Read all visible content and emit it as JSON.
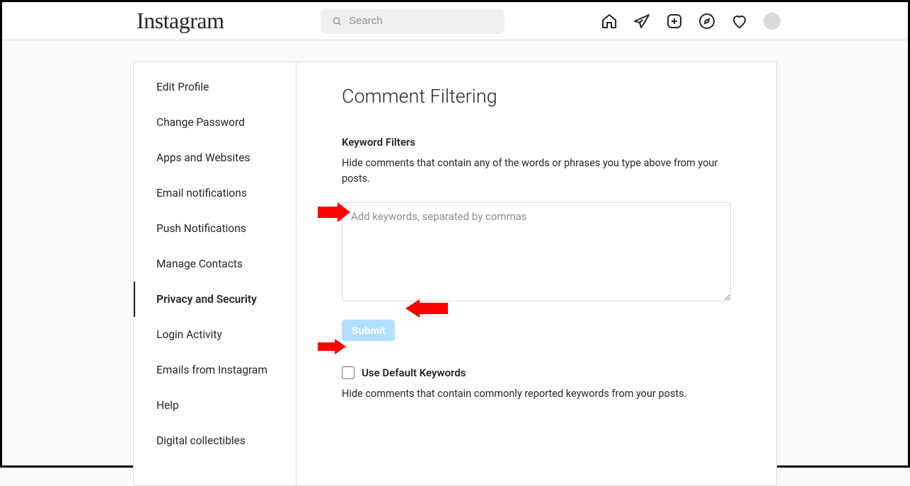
{
  "header": {
    "logo_text": "Instagram",
    "search_placeholder": "Search"
  },
  "sidebar": {
    "items": [
      {
        "label": "Edit Profile"
      },
      {
        "label": "Change Password"
      },
      {
        "label": "Apps and Websites"
      },
      {
        "label": "Email notifications"
      },
      {
        "label": "Push Notifications"
      },
      {
        "label": "Manage Contacts"
      },
      {
        "label": "Privacy and Security"
      },
      {
        "label": "Login Activity"
      },
      {
        "label": "Emails from Instagram"
      },
      {
        "label": "Help"
      },
      {
        "label": "Digital collectibles"
      }
    ],
    "active_index": 6
  },
  "main": {
    "title": "Comment Filtering",
    "keyword": {
      "heading": "Keyword Filters",
      "description": "Hide comments that contain any of the words or phrases you type above from your posts.",
      "placeholder": "Add keywords, separated by commas",
      "submit_label": "Submit"
    },
    "default": {
      "checkbox_label": "Use Default Keywords",
      "description": "Hide comments that contain commonly reported keywords from your posts."
    }
  }
}
